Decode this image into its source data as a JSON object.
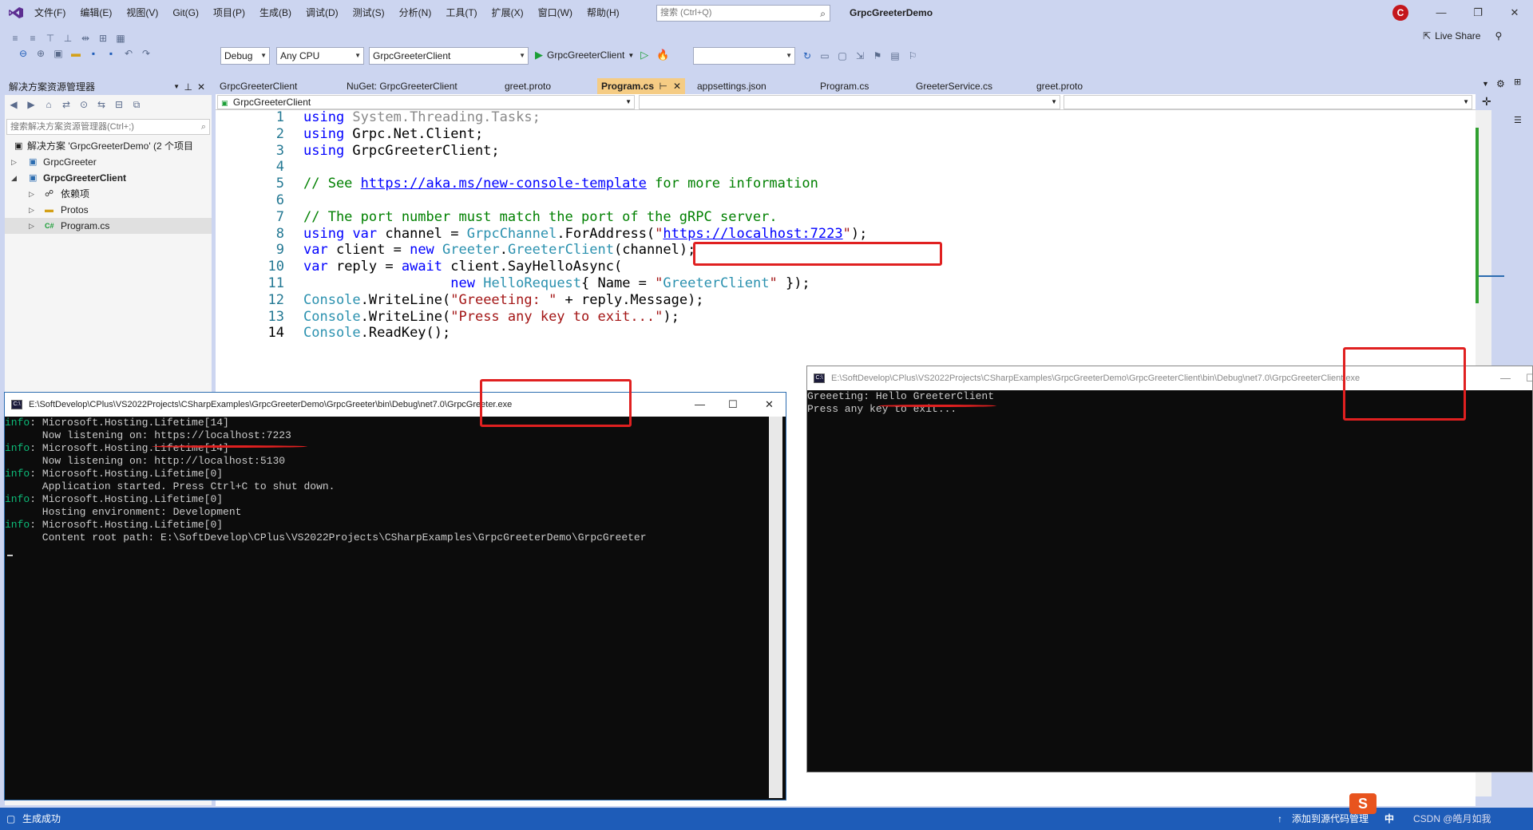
{
  "menu": [
    "文件(F)",
    "编辑(E)",
    "视图(V)",
    "Git(G)",
    "项目(P)",
    "生成(B)",
    "调试(D)",
    "测试(S)",
    "分析(N)",
    "工具(T)",
    "扩展(X)",
    "窗口(W)",
    "帮助(H)"
  ],
  "search": {
    "placeholder": "搜索 (Ctrl+Q)"
  },
  "solution_title": "GrpcGreeterDemo",
  "avatar_letter": "C",
  "toolbar": {
    "config": "Debug",
    "platform": "Any CPU",
    "startup_project": "GrpcGreeterClient",
    "run_label": "GrpcGreeterClient",
    "live_share": "Live Share"
  },
  "solution_explorer": {
    "title": "解决方案资源管理器",
    "search_placeholder": "搜索解决方案资源管理器(Ctrl+;)",
    "items": [
      {
        "label": "解决方案 'GrpcGreeterDemo' (2 个项目"
      },
      {
        "label": "GrpcGreeter"
      },
      {
        "label": "GrpcGreeterClient"
      },
      {
        "label": "依赖项"
      },
      {
        "label": "Protos"
      },
      {
        "label": "Program.cs"
      }
    ]
  },
  "tabs": [
    "GrpcGreeterClient",
    "NuGet: GrpcGreeterClient",
    "greet.proto",
    "Program.cs",
    "appsettings.json",
    "Program.cs",
    "GreeterService.cs",
    "greet.proto"
  ],
  "navbar": {
    "project": "GrpcGreeterClient"
  },
  "editor": {
    "line_numbers": [
      "1",
      "2",
      "3",
      "4",
      "5",
      "6",
      "7",
      "8",
      "9",
      "10",
      "11",
      "12",
      "13",
      "14"
    ],
    "lines": [
      "using System.Threading.Tasks;",
      "using Grpc.Net.Client;",
      "using GrpcGreeterClient;",
      "",
      "// See https://aka.ms/new-console-template for more information",
      "",
      "// The port number must match the port of the gRPC server.",
      "using var channel = GrpcChannel.ForAddress(\"https://localhost:7223\");",
      "var client = new Greeter.GreeterClient(channel);",
      "var reply = await client.SayHelloAsync(",
      "                  new HelloRequest{ Name = \"GreeterClient\" });",
      "Console.WriteLine(\"Greeeting: \" + reply.Message);",
      "Console.WriteLine(\"Press any key to exit...\");",
      "Console.ReadKey();"
    ]
  },
  "console_server": {
    "title": "E:\\SoftDevelop\\CPlus\\VS2022Projects\\CSharpExamples\\GrpcGreeterDemo\\GrpcGreeter\\bin\\Debug\\net7.0\\GrpcGreeter.exe",
    "lines": [
      {
        "tag": "info",
        "text": ": Microsoft.Hosting.Lifetime[14]"
      },
      {
        "tag": "",
        "text": "      Now listening on: https://localhost:7223"
      },
      {
        "tag": "info",
        "text": ": Microsoft.Hosting.Lifetime[14]"
      },
      {
        "tag": "",
        "text": "      Now listening on: http://localhost:5130"
      },
      {
        "tag": "info",
        "text": ": Microsoft.Hosting.Lifetime[0]"
      },
      {
        "tag": "",
        "text": "      Application started. Press Ctrl+C to shut down."
      },
      {
        "tag": "info",
        "text": ": Microsoft.Hosting.Lifetime[0]"
      },
      {
        "tag": "",
        "text": "      Hosting environment: Development"
      },
      {
        "tag": "info",
        "text": ": Microsoft.Hosting.Lifetime[0]"
      },
      {
        "tag": "",
        "text": "      Content root path: E:\\SoftDevelop\\CPlus\\VS2022Projects\\CSharpExamples\\GrpcGreeterDemo\\GrpcGreeter"
      }
    ]
  },
  "console_client": {
    "title": "E:\\SoftDevelop\\CPlus\\VS2022Projects\\CSharpExamples\\GrpcGreeterDemo\\GrpcGreeterClient\\bin\\Debug\\net7.0\\GrpcGreeterClient.exe",
    "lines": [
      "Greeeting: Hello GreeterClient",
      "Press any key to exit..."
    ]
  },
  "status": {
    "left": "生成成功",
    "right": "添加到源代码管理",
    "ime": "中",
    "watermark": "CSDN @皓月如我"
  },
  "colors": {
    "accent": "#1e5cb8",
    "highlight": "#e02020",
    "tab_active": "#f5cc84"
  }
}
